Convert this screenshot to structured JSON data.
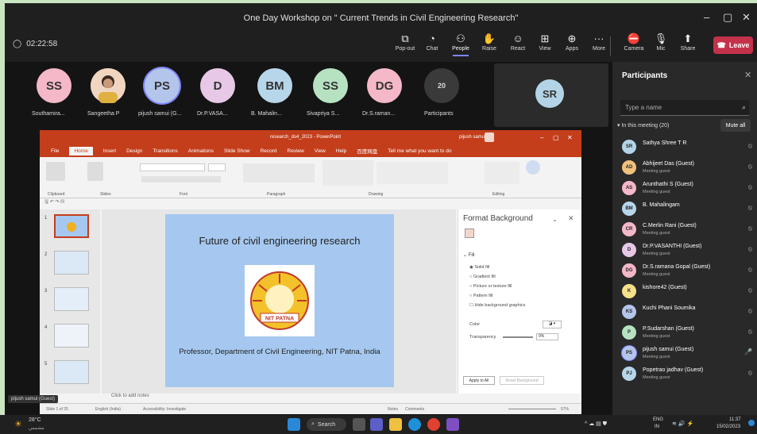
{
  "window": {
    "title": "One Day Workshop on \" Current Trends in Civil Engineering Research\""
  },
  "meeting": {
    "timer": "02:22:58"
  },
  "toolbar": {
    "items": [
      {
        "label": "Pop-out",
        "icon": "pop-out-icon"
      },
      {
        "label": "Chat",
        "icon": "chat-icon"
      },
      {
        "label": "People",
        "icon": "people-icon"
      },
      {
        "label": "Raise",
        "icon": "raise-hand-icon"
      },
      {
        "label": "React",
        "icon": "react-icon"
      },
      {
        "label": "View",
        "icon": "view-icon"
      },
      {
        "label": "Apps",
        "icon": "apps-icon"
      },
      {
        "label": "More",
        "icon": "more-icon"
      },
      {
        "label": "Camera",
        "icon": "camera-icon"
      },
      {
        "label": "Mic",
        "icon": "mic-icon"
      },
      {
        "label": "Share",
        "icon": "share-icon"
      }
    ],
    "leave_label": "Leave"
  },
  "gallery": [
    {
      "initials": "SS",
      "name": "Southamira...",
      "color": "#f4b8c8"
    },
    {
      "initials": "",
      "name": "Sangeetha P",
      "color": "#d9a077"
    },
    {
      "initials": "PS",
      "name": "pijush samui (G...",
      "color": "#b3c5ea"
    },
    {
      "initials": "D",
      "name": "Dr.P.VASA...",
      "color": "#e7c8e6"
    },
    {
      "initials": "BM",
      "name": "B. Mahalin...",
      "color": "#b7d6ea"
    },
    {
      "initials": "SS",
      "name": "Sivapriya S...",
      "color": "#b6e2c2"
    },
    {
      "initials": "DG",
      "name": "Dr.S.raman...",
      "color": "#f4b8c8"
    },
    {
      "initials": "20",
      "name": "Participants",
      "color": "#3a3a3a"
    }
  ],
  "sr_tile": {
    "initials": "SR"
  },
  "ppt": {
    "doc_title": "research_ds4_2023 - PowerPoint",
    "user": "pijush samui",
    "tabs": [
      "File",
      "Home",
      "Insert",
      "Design",
      "Transitions",
      "Animations",
      "Slide Show",
      "Record",
      "Review",
      "View",
      "Help",
      "百度网盘",
      "Tell me what you want to do"
    ],
    "ribbon_groups": [
      "Clipboard",
      "Slides",
      "Font",
      "Paragraph",
      "Drawing",
      "Editing"
    ],
    "slide_title": "Future of civil engineering research",
    "logo_text": "NIT PATNA",
    "slide_subtitle": "Professor, Department of Civil Engineering, NIT Patna, India",
    "thumb_numbers": [
      "1",
      "2",
      "3",
      "4",
      "5"
    ],
    "notes_placeholder": "Click to add notes",
    "status": {
      "left": "Slide 1 of 25",
      "lang": "English (India)",
      "acc": "Accessibility: Investigate",
      "notes": "Notes",
      "comments": "Comments",
      "zoom": "57%"
    }
  },
  "format_bg": {
    "title": "Format Background",
    "fill_label": "Fill",
    "options": [
      "Solid fill",
      "Gradient fill",
      "Picture or texture fill",
      "Pattern fill",
      "Hide background graphics"
    ],
    "color_label": "Color",
    "transparency_label": "Transparency",
    "transparency_value": "0%",
    "apply_all": "Apply to All",
    "reset": "Reset Background"
  },
  "presenter_label": "pijush samui (Guest)",
  "participants": {
    "title": "Participants",
    "search_placeholder": "Type a name",
    "in_meeting": "In this meeting (20)",
    "mute_all": "Mute all",
    "list": [
      {
        "initials": "SR",
        "name": "Sathya Shree T R",
        "sub": "",
        "color": "#b3d4e6"
      },
      {
        "initials": "AD",
        "name": "Abhijeet Das (Guest)",
        "sub": "Meeting guest",
        "color": "#f1c27d"
      },
      {
        "initials": "AS",
        "name": "Arunthathi S (Guest)",
        "sub": "Meeting guest",
        "color": "#f4b8c8"
      },
      {
        "initials": "BM",
        "name": "B. Mahalingam",
        "sub": "",
        "color": "#b7d6ea"
      },
      {
        "initials": "CR",
        "name": "C.Merlin Rani (Guest)",
        "sub": "Meeting guest",
        "color": "#f4b8c8"
      },
      {
        "initials": "D",
        "name": "Dr.P.VASANTHI (Guest)",
        "sub": "Meeting guest",
        "color": "#e7c8e6"
      },
      {
        "initials": "DG",
        "name": "Dr.S.ramana Gopal (Guest)",
        "sub": "Meeting guest",
        "color": "#f4b8c8"
      },
      {
        "initials": "K",
        "name": "kishore42 (Guest)",
        "sub": "",
        "color": "#f6e08a"
      },
      {
        "initials": "KS",
        "name": "Kuchi Phani Soumika",
        "sub": "",
        "color": "#b3c5ea"
      },
      {
        "initials": "P",
        "name": "P.Sudarshan (Guest)",
        "sub": "Meeting guest",
        "color": "#b6e2c2"
      },
      {
        "initials": "PS",
        "name": "pijush samui (Guest)",
        "sub": "Meeting guest",
        "color": "#b3c5ea"
      },
      {
        "initials": "PJ",
        "name": "Popetrao jadhav (Guest)",
        "sub": "Meeting guest",
        "color": "#b7d6ea"
      }
    ]
  },
  "taskbar": {
    "weather_temp": "28°C",
    "weather_desc": "مشمس",
    "search_label": "Search",
    "lang": "ENG",
    "lang2": "IN",
    "time": "11:37",
    "date": "15/02/2023"
  }
}
